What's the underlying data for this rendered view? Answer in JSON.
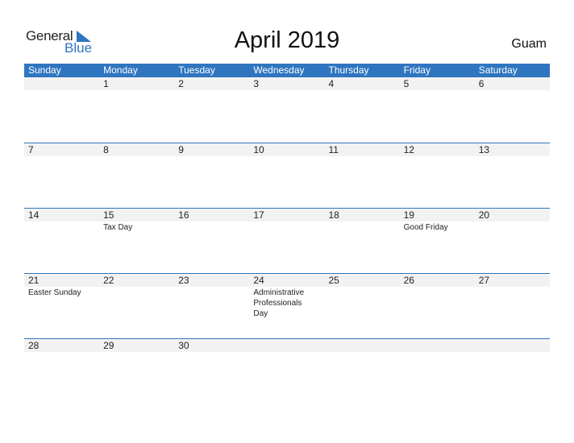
{
  "logo": {
    "general": "General",
    "blue": "Blue"
  },
  "title": "April 2019",
  "country": "Guam",
  "colors": {
    "accent": "#2f75c0",
    "band": "#f2f2f2"
  },
  "weekdays": [
    "Sunday",
    "Monday",
    "Tuesday",
    "Wednesday",
    "Thursday",
    "Friday",
    "Saturday"
  ],
  "weeks": [
    [
      {
        "d": ""
      },
      {
        "d": "1"
      },
      {
        "d": "2"
      },
      {
        "d": "3"
      },
      {
        "d": "4"
      },
      {
        "d": "5"
      },
      {
        "d": "6"
      }
    ],
    [
      {
        "d": "7"
      },
      {
        "d": "8"
      },
      {
        "d": "9"
      },
      {
        "d": "10"
      },
      {
        "d": "11"
      },
      {
        "d": "12"
      },
      {
        "d": "13"
      }
    ],
    [
      {
        "d": "14"
      },
      {
        "d": "15",
        "e": "Tax Day"
      },
      {
        "d": "16"
      },
      {
        "d": "17"
      },
      {
        "d": "18"
      },
      {
        "d": "19",
        "e": "Good Friday"
      },
      {
        "d": "20"
      }
    ],
    [
      {
        "d": "21",
        "e": "Easter Sunday"
      },
      {
        "d": "22"
      },
      {
        "d": "23"
      },
      {
        "d": "24",
        "e": "Administrative Professionals Day"
      },
      {
        "d": "25"
      },
      {
        "d": "26"
      },
      {
        "d": "27"
      }
    ],
    [
      {
        "d": "28"
      },
      {
        "d": "29"
      },
      {
        "d": "30"
      },
      {
        "d": ""
      },
      {
        "d": ""
      },
      {
        "d": ""
      },
      {
        "d": ""
      }
    ]
  ]
}
